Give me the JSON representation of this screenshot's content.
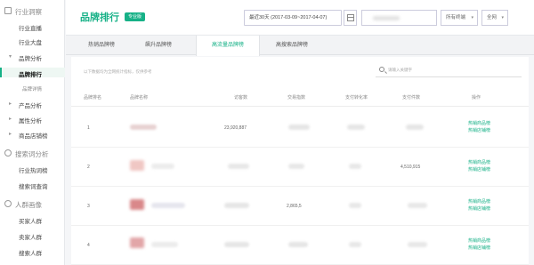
{
  "sidebar": {
    "sections": [
      {
        "label": "行业洞察",
        "icon": "monitor-icon"
      },
      {
        "label": "搜索词分析",
        "icon": "search-icon"
      },
      {
        "label": "人群画像",
        "icon": "user-icon"
      }
    ],
    "industry_items": [
      "行业直播",
      "行业大盘"
    ],
    "brand_group": "品牌分析",
    "brand_items": [
      "品牌排行",
      "品牌详情"
    ],
    "groups": [
      "产品分析",
      "属性分析",
      "商品店铺榜"
    ],
    "search_items": [
      "行业热词榜",
      "搜索词查询"
    ],
    "crowd_items": [
      "买家人群",
      "卖家人群",
      "搜索人群"
    ]
  },
  "header": {
    "title": "品牌排行",
    "badge": "专业版",
    "date_range": "最近30天 (2017-03-09~2017-04-07)",
    "dropdowns": [
      "所有终端",
      "全网"
    ]
  },
  "tabs": [
    "热销品牌榜",
    "飙升品牌榜",
    "高流量品牌榜",
    "高搜索品牌榜"
  ],
  "active_tab": 2,
  "content": {
    "info_text": "以下数据均为全网统计指标，仅供参考",
    "search_placeholder": "请输入关键字"
  },
  "table": {
    "columns": [
      "品牌排名",
      "品牌名称",
      "访客数",
      "交易指数",
      "支付转化率",
      "支付件数",
      "操作"
    ],
    "rows": [
      {
        "rank": "1",
        "visitors": "23,920,887",
        "ops": [
          "热销商品榜",
          "热销店铺榜"
        ]
      },
      {
        "rank": "2",
        "visitors": "",
        "paid": "4,510,915",
        "ops": [
          "热销商品榜",
          "热销店铺榜"
        ]
      },
      {
        "rank": "3",
        "visitors": "",
        "trade": "2,865,5",
        "ops": [
          "热销商品榜",
          "热销店铺榜"
        ]
      },
      {
        "rank": "4",
        "visitors": "",
        "ops": [
          "热销商品榜",
          "热销店铺榜"
        ]
      }
    ]
  },
  "colors": {
    "accent": "#17b187"
  }
}
